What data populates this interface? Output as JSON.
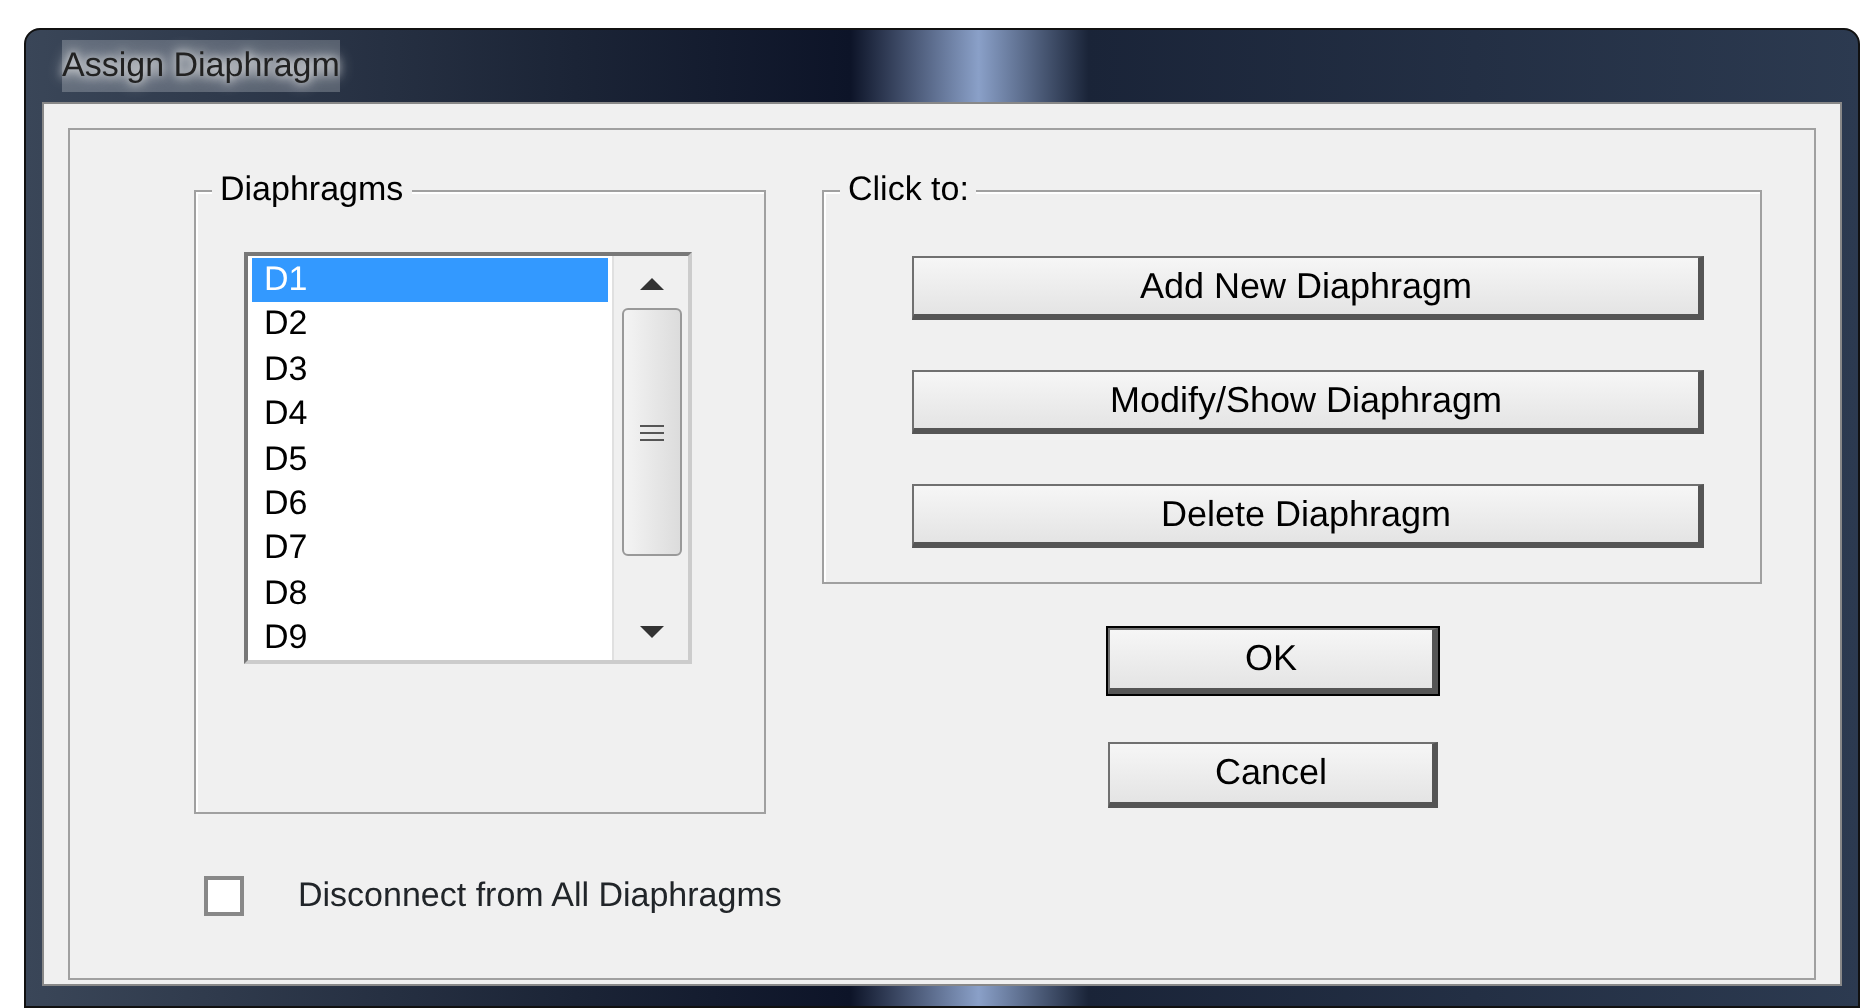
{
  "window": {
    "title": "Assign Diaphragm"
  },
  "diaphragms": {
    "label": "Diaphragms",
    "items": [
      {
        "label": "D1",
        "selected": true
      },
      {
        "label": "D2",
        "selected": false
      },
      {
        "label": "D3",
        "selected": false
      },
      {
        "label": "D4",
        "selected": false
      },
      {
        "label": "D5",
        "selected": false
      },
      {
        "label": "D6",
        "selected": false
      },
      {
        "label": "D7",
        "selected": false
      },
      {
        "label": "D8",
        "selected": false
      },
      {
        "label": "D9",
        "selected": false
      }
    ]
  },
  "click_to": {
    "label": "Click to:",
    "buttons": [
      "Add New Diaphragm",
      "Modify/Show Diaphragm",
      "Delete Diaphragm"
    ]
  },
  "buttons": [
    {
      "label": "OK",
      "focused": true
    },
    {
      "label": "Cancel",
      "focused": false
    }
  ],
  "disconnect": {
    "label": "Disconnect from All Diaphragms",
    "checked": false
  }
}
